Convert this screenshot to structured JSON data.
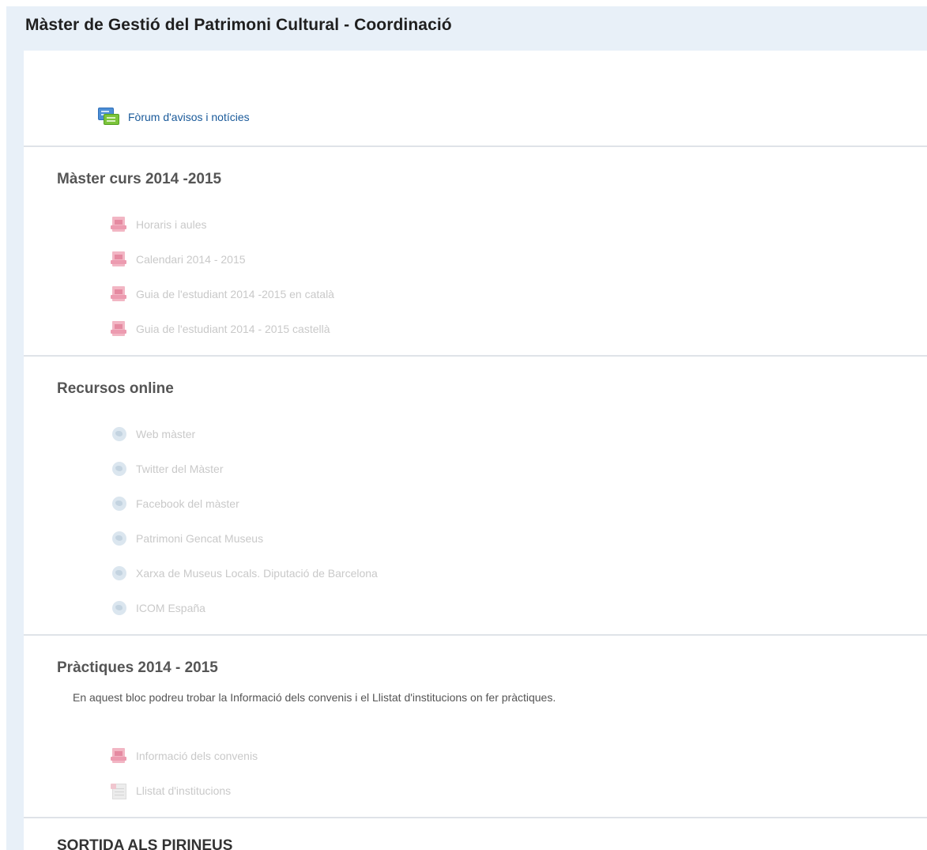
{
  "course": {
    "title": "Màster de Gestió del Patrimoni Cultural - Coordinació"
  },
  "sections": [
    {
      "title": "",
      "activities": [
        {
          "label": "Fòrum d'avisos i notícies",
          "icon": "forum-icon",
          "dimmed": false
        }
      ]
    },
    {
      "title": "Màster curs 2014 -2015",
      "activities": [
        {
          "label": "Horaris i aules",
          "icon": "pdf-icon",
          "dimmed": true
        },
        {
          "label": "Calendari 2014 - 2015",
          "icon": "pdf-icon",
          "dimmed": true
        },
        {
          "label": "Guia de l'estudiant 2014 -2015 en català",
          "icon": "pdf-icon",
          "dimmed": true
        },
        {
          "label": "Guia de l'estudiant 2014 - 2015 castellà",
          "icon": "pdf-icon",
          "dimmed": true
        }
      ]
    },
    {
      "title": "Recursos online",
      "activities": [
        {
          "label": "Web màster",
          "icon": "url-icon",
          "dimmed": true
        },
        {
          "label": "Twitter del Màster",
          "icon": "url-icon",
          "dimmed": true
        },
        {
          "label": "Facebook del màster",
          "icon": "url-icon",
          "dimmed": true
        },
        {
          "label": "Patrimoni Gencat Museus",
          "icon": "url-icon",
          "dimmed": true
        },
        {
          "label": "Xarxa de Museus Locals. Diputació de Barcelona",
          "icon": "url-icon",
          "dimmed": true
        },
        {
          "label": "ICOM España",
          "icon": "url-icon",
          "dimmed": true
        }
      ]
    },
    {
      "title": "Pràctiques 2014 - 2015",
      "summary": "En aquest bloc podreu trobar la Informació dels convenis i el Llistat d'institucions on fer pràctiques.",
      "activities": [
        {
          "label": "Informació dels convenis",
          "icon": "pdf-icon",
          "dimmed": true
        },
        {
          "label": "Llistat d'institucions",
          "icon": "spreadsheet-icon",
          "dimmed": true
        }
      ]
    },
    {
      "title": "SORTIDA ALS PIRINEUS",
      "activities": []
    }
  ],
  "colors": {
    "page_background": "#e8f0f8",
    "link": "#1a5a9a",
    "dimmed_text": "#c9c9c9",
    "section_title": "#555555"
  }
}
